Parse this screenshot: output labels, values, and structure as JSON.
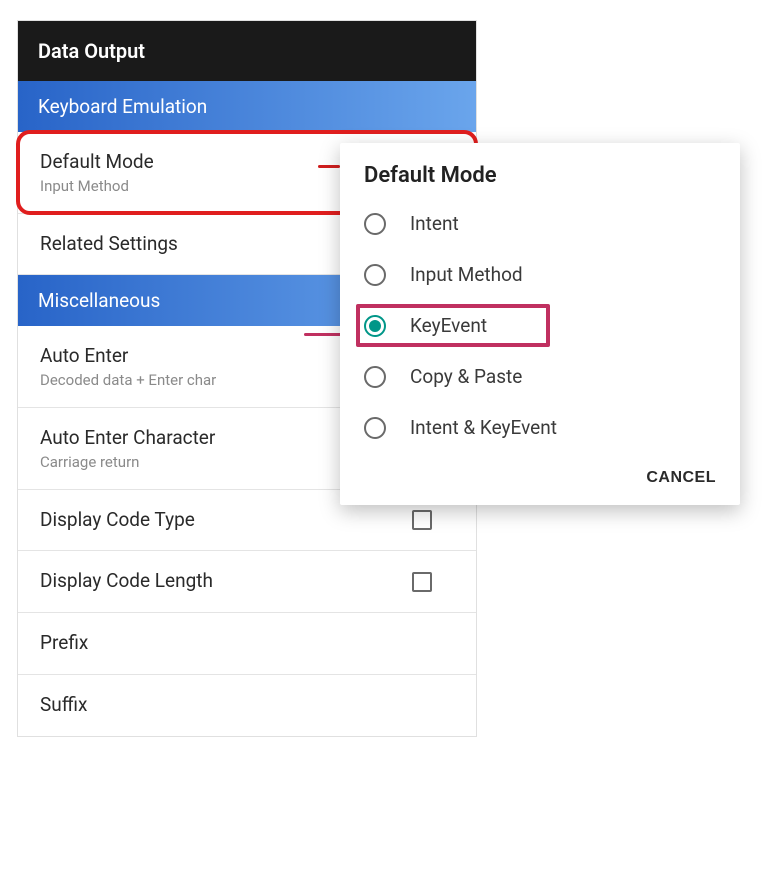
{
  "title": "Data Output",
  "sections": [
    {
      "label": "Keyboard Emulation"
    },
    {
      "label": "Miscellaneous"
    }
  ],
  "items": {
    "default_mode": {
      "title": "Default Mode",
      "sub": "Input Method"
    },
    "related_settings": {
      "title": "Related Settings"
    },
    "auto_enter": {
      "title": "Auto Enter",
      "sub": "Decoded data + Enter char"
    },
    "auto_enter_char": {
      "title": "Auto Enter Character",
      "sub": "Carriage return"
    },
    "display_code_type": {
      "title": "Display Code Type"
    },
    "display_code_length": {
      "title": "Display Code Length"
    },
    "prefix": {
      "title": "Prefix"
    },
    "suffix": {
      "title": "Suffix"
    }
  },
  "dialog": {
    "title": "Default Mode",
    "options": [
      {
        "label": "Intent",
        "selected": false
      },
      {
        "label": "Input Method",
        "selected": false
      },
      {
        "label": "KeyEvent",
        "selected": true
      },
      {
        "label": "Copy & Paste",
        "selected": false
      },
      {
        "label": "Intent & KeyEvent",
        "selected": false
      }
    ],
    "cancel": "CANCEL"
  }
}
